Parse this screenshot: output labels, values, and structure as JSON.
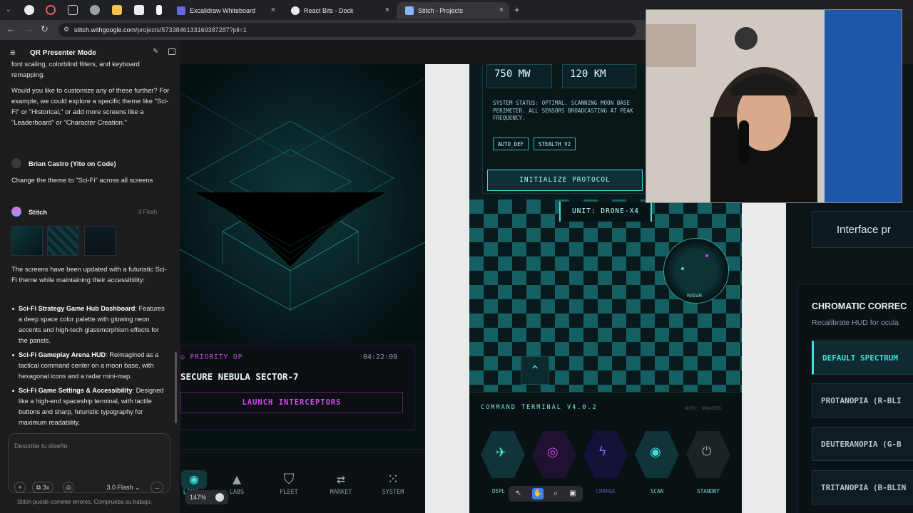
{
  "browser": {
    "tabs": [
      {
        "title": "Excalidraw Whiteboard",
        "color": "#6965db"
      },
      {
        "title": "React Bits - Dock",
        "color": "#ffffff"
      },
      {
        "title": "Stitch - Projects",
        "color": "#8ab4f8"
      }
    ],
    "url_host": "stitch.withgoogle.com",
    "url_path": "/projects/5733846133169387287?pli=1"
  },
  "chat": {
    "title": "QR Presenter Mode",
    "intro_cut": "font scaling, colorblind filters, and keyboard remapping.",
    "question": "Would you like to customize any of these further? For example, we could explore a specific theme like \"Sci-Fi\" or \"Historical,\" or add more screens like a \"Leaderboard\" or \"Character Creation.\"",
    "user_name": "Brian Castro (Yito on Code)",
    "user_message": "Change the theme to \"Sci-Fi\" across all screens",
    "agent_name": "Stitch",
    "agent_model": "3 Flash",
    "agent_reply": "The screens have been updated with a futuristic Sci-Fi theme while maintaining their accessibility:",
    "bullets": [
      {
        "title": "Sci-Fi Strategy Game Hub Dashboard",
        "text": ": Features a deep space color palette with glowing neon accents and high-tech glassmorphism effects for the panels."
      },
      {
        "title": "Sci-Fi Gameplay Arena HUD",
        "text": ": Reimagined as a tactical command center on a moon base, with hexagonal icons and a radar mini-map."
      },
      {
        "title": "Sci-Fi Game Settings & Accessibility",
        "text": ": Designed like a high-end spaceship terminal, with tactile buttons and sharp, futuristic typography for maximum readability."
      }
    ],
    "input_placeholder": "Describe tu diseño",
    "count_badge": "3x",
    "model_select": "3.0 Flash",
    "disclaimer": "Stitch puede cometer errores. Comprueba su trabajo."
  },
  "screen1": {
    "priority": "PRIORITY OP",
    "timer": "04:22:09",
    "mission": "SECURE NEBULA SECTOR-7",
    "launch": "LAUNCH INTERCEPTORS",
    "nav": [
      "LAXY",
      "LABS",
      "FLEET",
      "MARKET",
      "SYSTEM"
    ],
    "zoom": "147%"
  },
  "screen2": {
    "stat_power": "750 MW",
    "stat_range": "120 KM",
    "system_status": "SYSTEM STATUS: OPTIMAL. SCANNING MOON BASE PERIMETER. ALL SENSORS BROADCASTING AT PEAK FREQUENCY.",
    "tags": [
      "AUTO_DEF",
      "STEALTH_V2"
    ],
    "init_btn": "INITIALIZE PROTOCOL",
    "unit": "UNIT: DRONE-X4",
    "radar": "RADAR",
    "terminal": "COMMAND TERMINAL V4.0.2",
    "auth": "AUTH: GRANTED",
    "actions": [
      "DEPL",
      "",
      "CHARGE",
      "SCAN",
      "STANDBY"
    ]
  },
  "screen3": {
    "corner": "10",
    "interface": "Interface pr",
    "chromatic": "CHROMATIC CORREC",
    "recalibrate": "Recalibrate HUD for ocula",
    "options": [
      "DEFAULT SPECTRUM",
      "PROTANOPIA (R-BLI",
      "DEUTERANOPIA (G-B",
      "TRITANOPIA (B-BLIN"
    ]
  },
  "colors": {
    "neon": "#3ee0d8",
    "magenta": "#d946ef",
    "accent_purple": "#a855f7"
  }
}
